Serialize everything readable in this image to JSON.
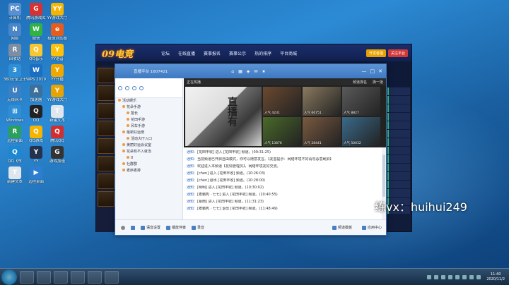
{
  "desktop": {
    "icons": [
      {
        "label": "计算机",
        "color": "#5a8fd0",
        "glyph": "PC"
      },
      {
        "label": "腾讯游戏库",
        "color": "#d93030",
        "glyph": "G"
      },
      {
        "label": "YY游戏大厅",
        "color": "#f5b400",
        "glyph": "YY"
      },
      {
        "label": "网络",
        "color": "#4a86c8",
        "glyph": "N"
      },
      {
        "label": "微信",
        "color": "#2fb344",
        "glyph": "W"
      },
      {
        "label": "极速浏览器",
        "color": "#e65c1c",
        "glyph": "e"
      },
      {
        "label": "回收站",
        "color": "#7d8ea3",
        "glyph": "R"
      },
      {
        "label": "QQ音乐",
        "color": "#f7c631",
        "glyph": "Q"
      },
      {
        "label": "YY语音",
        "color": "#ffc107",
        "glyph": "Y"
      },
      {
        "label": "360安全卫士",
        "color": "#2e8fd6",
        "glyph": "3"
      },
      {
        "label": "WPS 2019",
        "color": "#1a6fc2",
        "glyph": "W"
      },
      {
        "label": "YY开播",
        "color": "#f0a800",
        "glyph": "Y"
      },
      {
        "label": "无线网卡",
        "color": "#3c7fc2",
        "glyph": "U"
      },
      {
        "label": "加速器",
        "color": "#3c6f9a",
        "glyph": "A"
      },
      {
        "label": "YY游戏大厅",
        "color": "#e8a300",
        "glyph": "Y"
      },
      {
        "label": "Windows",
        "color": "#2f8fd6",
        "glyph": "⊞"
      },
      {
        "label": "QQ",
        "color": "#222",
        "glyph": "Q"
      },
      {
        "label": "新建文本",
        "color": "#dfe6ee",
        "glyph": "T"
      },
      {
        "label": "远程桌面",
        "color": "#2aa05a",
        "glyph": "R"
      },
      {
        "label": "QQ游戏",
        "color": "#f4b400",
        "glyph": "Q"
      },
      {
        "label": "腾讯QQ",
        "color": "#d02f2f",
        "glyph": "Q"
      },
      {
        "label": "QQ飞车",
        "color": "#1d88d0",
        "glyph": "Q"
      },
      {
        "label": "YY",
        "color": "#23334d",
        "glyph": "Y"
      },
      {
        "label": "游戏加速",
        "color": "#333",
        "glyph": "G"
      },
      {
        "label": "新建文本",
        "color": "#dfe6ee",
        "glyph": "T"
      },
      {
        "label": "远程桌面",
        "color": "#2c7fd0",
        "glyph": "▶"
      }
    ]
  },
  "game_window": {
    "logo": "09电竞",
    "nav": [
      "论坛",
      "在线直播",
      "赛事报名",
      "赛事公示",
      "热的排序",
      "平台商城"
    ],
    "btn1": "开发者福",
    "btn2": "关注平台"
  },
  "yy": {
    "title_id": "直播平台  1607421",
    "winbtns": [
      "—",
      "□",
      "✕"
    ],
    "channel": {
      "rows": [
        {
          "text": "活动娱乐",
          "cls": ""
        },
        {
          "text": "花朵手游",
          "cls": "sub"
        },
        {
          "text": "警长",
          "cls": "sub2"
        },
        {
          "text": "花田手游",
          "cls": "sub2"
        },
        {
          "text": "风车手游",
          "cls": "sub2"
        },
        {
          "text": "最新好运榜",
          "cls": "sub"
        },
        {
          "text": "活动大厅入口",
          "cls": "sub2"
        },
        {
          "text": "美丽好运会议室",
          "cls": "sub"
        },
        {
          "text": "花朵有不入就当",
          "cls": "sub"
        },
        {
          "text": "0",
          "cls": "sub2"
        },
        {
          "text": "社群群",
          "cls": "sub"
        },
        {
          "text": "麦序麦排",
          "cls": "sub"
        }
      ]
    },
    "video": {
      "status": "正在热播",
      "top_right": [
        "频道排名",
        "换一批"
      ],
      "main_text": "直播有",
      "thumbs": [
        {
          "cap": "人气 4231",
          "color": "#6b4a30"
        },
        {
          "cap": "人气 66751",
          "color": "#8a7a60"
        },
        {
          "cap": "人气 8827",
          "color": "#5a5a5a"
        },
        {
          "cap": "人气 13876",
          "color": "#4a6a2a"
        },
        {
          "cap": "人气 28441",
          "color": "#7a5a40"
        },
        {
          "cap": "人气 50032",
          "color": "#3a6a8a"
        }
      ]
    },
    "chat": [
      {
        "lbl": "通知",
        "text": "[花田丰收] 进入 [花田丰收] 频道。(09:31:25)"
      },
      {
        "lbl": "通知",
        "text": "当前频道已开启自由模式，你可以随意发言。【友善提示：网络环境不好请勿恶意刷屏】"
      },
      {
        "lbl": "通知",
        "text": "欢迎进入本频道【友情管理员】，网络环境友好交流。"
      },
      {
        "lbl": "通知",
        "text": "[chen] 进入 [花田丰收] 频道。(10:26:03)"
      },
      {
        "lbl": "通知",
        "text": "[chen] 退出 [花田丰收] 频道。(10:28:00)"
      },
      {
        "lbl": "通知",
        "text": "[明明] 进入 [花田丰收] 频道。(10:30:02)"
      },
      {
        "lbl": "通知",
        "text": "[麦霸秀 · 七七] 进入 [花田丰收] 频道。(10:40:55)"
      },
      {
        "lbl": "通知",
        "text": "[慕雨] 进入 [花田丰收] 频道。(11:31:23)"
      },
      {
        "lbl": "通知",
        "text": "[麦霸秀 · 七七] 退出 [花田丰收] 频道。(11:48:49)"
      }
    ],
    "bottom": {
      "items": [
        "语音设置",
        "播放伴奏",
        "录音"
      ],
      "right": [
        "频道模板",
        "应用中心"
      ]
    }
  },
  "watermark": "练vx：huihui249",
  "taskbar": {
    "time": "11:40",
    "date": "2020/11/2"
  }
}
